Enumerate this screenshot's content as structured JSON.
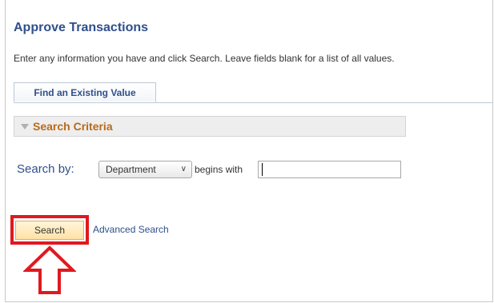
{
  "page": {
    "title": "Approve Transactions",
    "instructions": "Enter any information you have and click Search. Leave fields blank for a list of all values."
  },
  "tabs": [
    {
      "label": "Find an Existing Value",
      "active": true
    }
  ],
  "criteria": {
    "label": "Search Criteria",
    "expanded": true
  },
  "search": {
    "by_label": "Search by:",
    "field_selected": "Department",
    "operator_label": "begins with",
    "value": ""
  },
  "actions": {
    "search_label": "Search",
    "advanced_label": "Advanced Search"
  },
  "annotation": {
    "highlight_color": "#e0191f",
    "arrow_icon": "up-arrow-outline"
  },
  "colors": {
    "title": "#2f4f8a",
    "criteria_text": "#b86a1d",
    "search_button_bg": "#ffe2a6"
  }
}
